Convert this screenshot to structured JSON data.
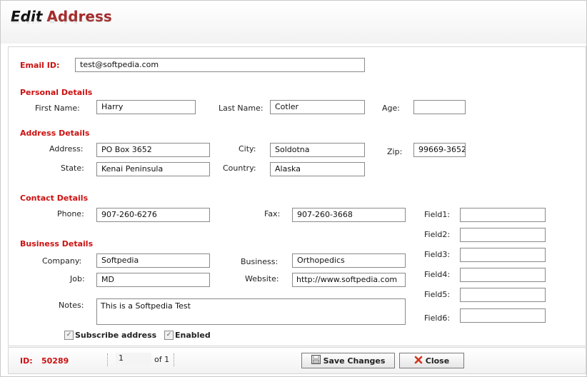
{
  "header": {
    "title_word1": "Edit",
    "title_word2": "Address"
  },
  "email": {
    "label": "Email ID:",
    "value": "test@softpedia.com"
  },
  "personal": {
    "section": "Personal Details",
    "first_name_label": "First Name:",
    "first_name": "Harry",
    "last_name_label": "Last Name:",
    "last_name": "Cotler",
    "age_label": "Age:",
    "age": ""
  },
  "address": {
    "section": "Address Details",
    "address_label": "Address:",
    "address": "PO Box 3652",
    "city_label": "City:",
    "city": "Soldotna",
    "zip_label": "Zip:",
    "zip": "99669-3652",
    "state_label": "State:",
    "state": "Kenai Peninsula",
    "country_label": "Country:",
    "country": "Alaska"
  },
  "contact": {
    "section": "Contact Details",
    "phone_label": "Phone:",
    "phone": "907-260-6276",
    "fax_label": "Fax:",
    "fax": "907-260-3668"
  },
  "fields": [
    {
      "label": "Field1:",
      "value": ""
    },
    {
      "label": "Field2:",
      "value": ""
    },
    {
      "label": "Field3:",
      "value": ""
    },
    {
      "label": "Field4:",
      "value": ""
    },
    {
      "label": "Field5:",
      "value": ""
    },
    {
      "label": "Field6:",
      "value": ""
    }
  ],
  "business": {
    "section": "Business Details",
    "company_label": "Company:",
    "company": "Softpedia",
    "business_label": "Business:",
    "business": "Orthopedics",
    "job_label": "Job:",
    "job": "MD",
    "website_label": "Website:",
    "website": "http://www.softpedia.com",
    "notes_label": "Notes:",
    "notes": "This is a Softpedia Test"
  },
  "checks": {
    "subscribe_label": "Subscribe address",
    "subscribe_checked": true,
    "enabled_label": "Enabled",
    "enabled_checked": true
  },
  "footer": {
    "id_label": "ID:",
    "id_value": "50289",
    "page_value": "1",
    "page_of": "of 1",
    "save_label": "Save Changes",
    "close_label": "Close"
  },
  "colors": {
    "accent_red": "#cc1111",
    "title_red": "#a52a2a"
  },
  "icons": {
    "save": "floppy-disk-icon",
    "close": "red-x-icon",
    "check": "checkmark-icon"
  }
}
